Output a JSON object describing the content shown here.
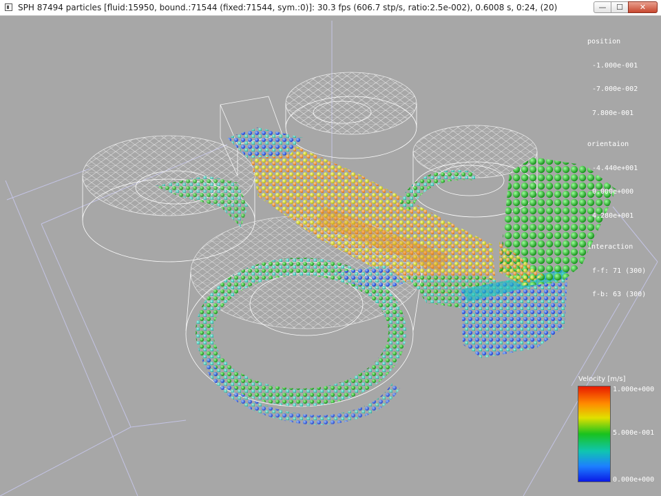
{
  "window": {
    "title": "SPH 87494 particles [fluid:15950, bound.:71544 (fixed:71544, sym.:0)]: 30.3 fps (606.7 stp/s, ratio:2.5e-002), 0.6008 s, 0:24, (20)",
    "minimize_symbol": "—",
    "maximize_symbol": "☐",
    "close_symbol": "✕"
  },
  "info_panel": {
    "position_label": "position",
    "position_values": [
      "-1.000e-001",
      "-7.000e-002",
      "7.800e-001"
    ],
    "orientation_label": "orientaion",
    "orientation_values": [
      "-4.440e+001",
      "0.000e+000",
      "4.280e+001"
    ],
    "interaction_label": "interaction",
    "interaction_values": [
      "f-f: 71 (300)",
      "f-b: 63 (300)"
    ]
  },
  "legend": {
    "title": "Velocity [m/s]",
    "max_label": "1.000e+000",
    "mid_label": "5.000e-001",
    "min_label": "0.000e+000"
  },
  "colors": {
    "background": "#a7a7a7",
    "wireframe": "#ffffff",
    "axis_lines": "#c8c8ee",
    "fast": "#e81a00",
    "medium": "#19c21e",
    "slow": "#0a1ae6"
  }
}
